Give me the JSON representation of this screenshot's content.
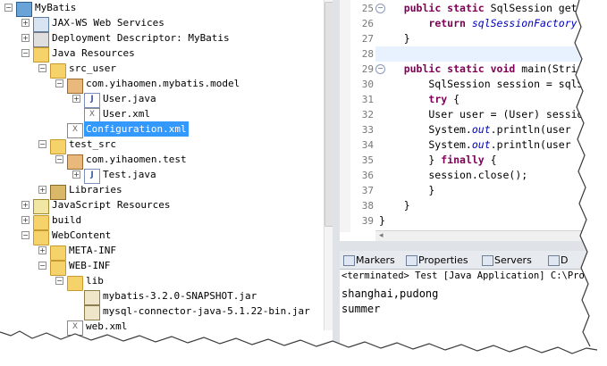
{
  "explorer": {
    "items": [
      {
        "label": "MyBatis",
        "icon": "project-icon",
        "toggle": "−",
        "depth": 0
      },
      {
        "label": "JAX-WS Web Services",
        "icon": "web-services-icon",
        "toggle": "+",
        "depth": 1
      },
      {
        "label": "Deployment Descriptor: MyBatis",
        "icon": "deployment-descriptor-icon",
        "toggle": "+",
        "depth": 1
      },
      {
        "label": "Java Resources",
        "icon": "java-resources-icon",
        "toggle": "−",
        "depth": 1
      },
      {
        "label": "src_user",
        "icon": "source-folder-icon",
        "toggle": "−",
        "depth": 2
      },
      {
        "label": "com.yihaomen.mybatis.model",
        "icon": "package-icon",
        "toggle": "−",
        "depth": 3
      },
      {
        "label": "User.java",
        "icon": "java-file-icon",
        "toggle": "+",
        "depth": 4
      },
      {
        "label": "User.xml",
        "icon": "xml-file-icon",
        "toggle": "",
        "depth": 4
      },
      {
        "label": "Configuration.xml",
        "icon": "xml-file-icon",
        "toggle": "",
        "depth": 3,
        "selected": true
      },
      {
        "label": "test_src",
        "icon": "source-folder-icon",
        "toggle": "−",
        "depth": 2
      },
      {
        "label": "com.yihaomen.test",
        "icon": "package-icon",
        "toggle": "−",
        "depth": 3
      },
      {
        "label": "Test.java",
        "icon": "java-file-icon",
        "toggle": "+",
        "depth": 4
      },
      {
        "label": "Libraries",
        "icon": "libraries-icon",
        "toggle": "+",
        "depth": 2
      },
      {
        "label": "JavaScript Resources",
        "icon": "javascript-resources-icon",
        "toggle": "+",
        "depth": 1
      },
      {
        "label": "build",
        "icon": "folder-icon",
        "toggle": "+",
        "depth": 1
      },
      {
        "label": "WebContent",
        "icon": "folder-icon",
        "toggle": "−",
        "depth": 1
      },
      {
        "label": "META-INF",
        "icon": "folder-icon",
        "toggle": "+",
        "depth": 2
      },
      {
        "label": "WEB-INF",
        "icon": "folder-icon",
        "toggle": "−",
        "depth": 2
      },
      {
        "label": "lib",
        "icon": "folder-icon",
        "toggle": "−",
        "depth": 3
      },
      {
        "label": "mybatis-3.2.0-SNAPSHOT.jar",
        "icon": "jar-file-icon",
        "toggle": "",
        "depth": 4
      },
      {
        "label": "mysql-connector-java-5.1.22-bin.jar",
        "icon": "jar-file-icon",
        "toggle": "",
        "depth": 4
      },
      {
        "label": "web.xml",
        "icon": "xml-file-icon",
        "toggle": "",
        "depth": 3
      }
    ]
  },
  "editor": {
    "lines": [
      {
        "n": "25",
        "fold": "−",
        "parts": [
          [
            "    ",
            ""
          ],
          [
            "public static ",
            "kw"
          ],
          [
            "SqlSession getSession",
            ""
          ]
        ]
      },
      {
        "n": "26",
        "fold": "",
        "parts": [
          [
            "        ",
            ""
          ],
          [
            "return ",
            "kw"
          ],
          [
            "sqlSessionFactory",
            "fld"
          ]
        ]
      },
      {
        "n": "27",
        "fold": "",
        "parts": [
          [
            "    }",
            ""
          ]
        ]
      },
      {
        "n": "28",
        "fold": "",
        "parts": [
          [
            "",
            ""
          ]
        ]
      },
      {
        "n": "29",
        "fold": "−",
        "parts": [
          [
            "    ",
            ""
          ],
          [
            "public static void ",
            "kw"
          ],
          [
            "main(String[] args)",
            ""
          ]
        ]
      },
      {
        "n": "30",
        "fold": "",
        "parts": [
          [
            "        SqlSession session = sqlSessionFactory",
            ""
          ]
        ]
      },
      {
        "n": "31",
        "fold": "",
        "parts": [
          [
            "        ",
            ""
          ],
          [
            "try",
            "kw"
          ],
          [
            " {",
            ""
          ]
        ]
      },
      {
        "n": "32",
        "fold": "",
        "parts": [
          [
            "        User user = (User) session",
            ""
          ]
        ]
      },
      {
        "n": "33",
        "fold": "",
        "parts": [
          [
            "        System.",
            ""
          ],
          [
            "out",
            "fld"
          ],
          [
            ".println(user",
            ""
          ]
        ]
      },
      {
        "n": "34",
        "fold": "",
        "parts": [
          [
            "        System.",
            ""
          ],
          [
            "out",
            "fld"
          ],
          [
            ".println(user",
            ""
          ]
        ]
      },
      {
        "n": "35",
        "fold": "",
        "parts": [
          [
            "        } ",
            ""
          ],
          [
            "finally",
            "kw"
          ],
          [
            " {",
            ""
          ]
        ]
      },
      {
        "n": "36",
        "fold": "",
        "parts": [
          [
            "        session.close();",
            ""
          ]
        ]
      },
      {
        "n": "37",
        "fold": "",
        "parts": [
          [
            "        }",
            ""
          ]
        ]
      },
      {
        "n": "38",
        "fold": "",
        "parts": [
          [
            "    }",
            ""
          ]
        ]
      },
      {
        "n": "39",
        "fold": "",
        "parts": [
          [
            "}",
            ""
          ]
        ]
      }
    ]
  },
  "panel": {
    "tabs": [
      {
        "label": "Markers",
        "icon": "markers-icon"
      },
      {
        "label": "Properties",
        "icon": "properties-icon"
      },
      {
        "label": "Servers",
        "icon": "servers-icon"
      },
      {
        "label": "D",
        "icon": "data-source-icon"
      }
    ],
    "console_header": "<terminated> Test [Java Application] C:\\Prog",
    "console_lines": [
      "shanghai,pudong",
      "summer"
    ]
  },
  "colors": {
    "selection": "#3399ff",
    "keyword": "#7f0055",
    "field": "#0000c0",
    "current_line": "#e8f2fe"
  }
}
